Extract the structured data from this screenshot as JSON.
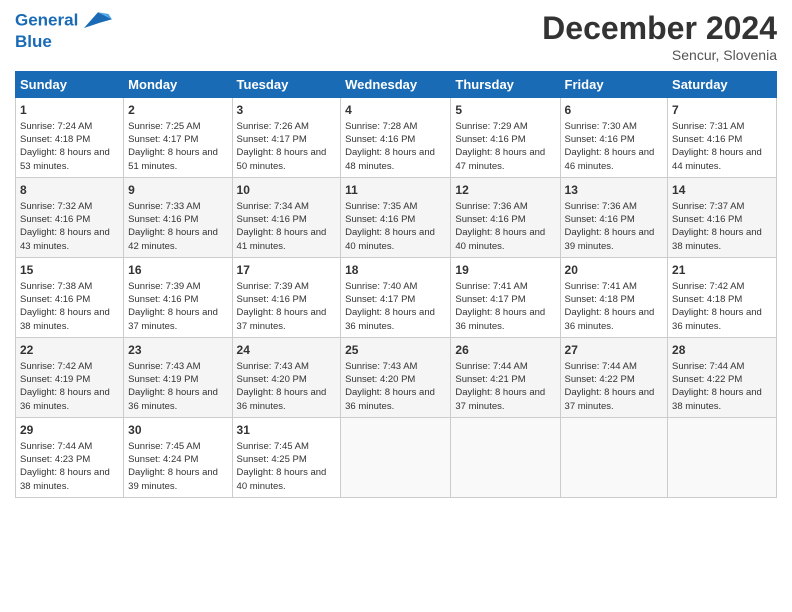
{
  "logo": {
    "line1": "General",
    "line2": "Blue"
  },
  "title": "December 2024",
  "subtitle": "Sencur, Slovenia",
  "headers": [
    "Sunday",
    "Monday",
    "Tuesday",
    "Wednesday",
    "Thursday",
    "Friday",
    "Saturday"
  ],
  "weeks": [
    [
      {
        "day": "1",
        "sunrise": "Sunrise: 7:24 AM",
        "sunset": "Sunset: 4:18 PM",
        "daylight": "Daylight: 8 hours and 53 minutes."
      },
      {
        "day": "2",
        "sunrise": "Sunrise: 7:25 AM",
        "sunset": "Sunset: 4:17 PM",
        "daylight": "Daylight: 8 hours and 51 minutes."
      },
      {
        "day": "3",
        "sunrise": "Sunrise: 7:26 AM",
        "sunset": "Sunset: 4:17 PM",
        "daylight": "Daylight: 8 hours and 50 minutes."
      },
      {
        "day": "4",
        "sunrise": "Sunrise: 7:28 AM",
        "sunset": "Sunset: 4:16 PM",
        "daylight": "Daylight: 8 hours and 48 minutes."
      },
      {
        "day": "5",
        "sunrise": "Sunrise: 7:29 AM",
        "sunset": "Sunset: 4:16 PM",
        "daylight": "Daylight: 8 hours and 47 minutes."
      },
      {
        "day": "6",
        "sunrise": "Sunrise: 7:30 AM",
        "sunset": "Sunset: 4:16 PM",
        "daylight": "Daylight: 8 hours and 46 minutes."
      },
      {
        "day": "7",
        "sunrise": "Sunrise: 7:31 AM",
        "sunset": "Sunset: 4:16 PM",
        "daylight": "Daylight: 8 hours and 44 minutes."
      }
    ],
    [
      {
        "day": "8",
        "sunrise": "Sunrise: 7:32 AM",
        "sunset": "Sunset: 4:16 PM",
        "daylight": "Daylight: 8 hours and 43 minutes."
      },
      {
        "day": "9",
        "sunrise": "Sunrise: 7:33 AM",
        "sunset": "Sunset: 4:16 PM",
        "daylight": "Daylight: 8 hours and 42 minutes."
      },
      {
        "day": "10",
        "sunrise": "Sunrise: 7:34 AM",
        "sunset": "Sunset: 4:16 PM",
        "daylight": "Daylight: 8 hours and 41 minutes."
      },
      {
        "day": "11",
        "sunrise": "Sunrise: 7:35 AM",
        "sunset": "Sunset: 4:16 PM",
        "daylight": "Daylight: 8 hours and 40 minutes."
      },
      {
        "day": "12",
        "sunrise": "Sunrise: 7:36 AM",
        "sunset": "Sunset: 4:16 PM",
        "daylight": "Daylight: 8 hours and 40 minutes."
      },
      {
        "day": "13",
        "sunrise": "Sunrise: 7:36 AM",
        "sunset": "Sunset: 4:16 PM",
        "daylight": "Daylight: 8 hours and 39 minutes."
      },
      {
        "day": "14",
        "sunrise": "Sunrise: 7:37 AM",
        "sunset": "Sunset: 4:16 PM",
        "daylight": "Daylight: 8 hours and 38 minutes."
      }
    ],
    [
      {
        "day": "15",
        "sunrise": "Sunrise: 7:38 AM",
        "sunset": "Sunset: 4:16 PM",
        "daylight": "Daylight: 8 hours and 38 minutes."
      },
      {
        "day": "16",
        "sunrise": "Sunrise: 7:39 AM",
        "sunset": "Sunset: 4:16 PM",
        "daylight": "Daylight: 8 hours and 37 minutes."
      },
      {
        "day": "17",
        "sunrise": "Sunrise: 7:39 AM",
        "sunset": "Sunset: 4:16 PM",
        "daylight": "Daylight: 8 hours and 37 minutes."
      },
      {
        "day": "18",
        "sunrise": "Sunrise: 7:40 AM",
        "sunset": "Sunset: 4:17 PM",
        "daylight": "Daylight: 8 hours and 36 minutes."
      },
      {
        "day": "19",
        "sunrise": "Sunrise: 7:41 AM",
        "sunset": "Sunset: 4:17 PM",
        "daylight": "Daylight: 8 hours and 36 minutes."
      },
      {
        "day": "20",
        "sunrise": "Sunrise: 7:41 AM",
        "sunset": "Sunset: 4:18 PM",
        "daylight": "Daylight: 8 hours and 36 minutes."
      },
      {
        "day": "21",
        "sunrise": "Sunrise: 7:42 AM",
        "sunset": "Sunset: 4:18 PM",
        "daylight": "Daylight: 8 hours and 36 minutes."
      }
    ],
    [
      {
        "day": "22",
        "sunrise": "Sunrise: 7:42 AM",
        "sunset": "Sunset: 4:19 PM",
        "daylight": "Daylight: 8 hours and 36 minutes."
      },
      {
        "day": "23",
        "sunrise": "Sunrise: 7:43 AM",
        "sunset": "Sunset: 4:19 PM",
        "daylight": "Daylight: 8 hours and 36 minutes."
      },
      {
        "day": "24",
        "sunrise": "Sunrise: 7:43 AM",
        "sunset": "Sunset: 4:20 PM",
        "daylight": "Daylight: 8 hours and 36 minutes."
      },
      {
        "day": "25",
        "sunrise": "Sunrise: 7:43 AM",
        "sunset": "Sunset: 4:20 PM",
        "daylight": "Daylight: 8 hours and 36 minutes."
      },
      {
        "day": "26",
        "sunrise": "Sunrise: 7:44 AM",
        "sunset": "Sunset: 4:21 PM",
        "daylight": "Daylight: 8 hours and 37 minutes."
      },
      {
        "day": "27",
        "sunrise": "Sunrise: 7:44 AM",
        "sunset": "Sunset: 4:22 PM",
        "daylight": "Daylight: 8 hours and 37 minutes."
      },
      {
        "day": "28",
        "sunrise": "Sunrise: 7:44 AM",
        "sunset": "Sunset: 4:22 PM",
        "daylight": "Daylight: 8 hours and 38 minutes."
      }
    ],
    [
      {
        "day": "29",
        "sunrise": "Sunrise: 7:44 AM",
        "sunset": "Sunset: 4:23 PM",
        "daylight": "Daylight: 8 hours and 38 minutes."
      },
      {
        "day": "30",
        "sunrise": "Sunrise: 7:45 AM",
        "sunset": "Sunset: 4:24 PM",
        "daylight": "Daylight: 8 hours and 39 minutes."
      },
      {
        "day": "31",
        "sunrise": "Sunrise: 7:45 AM",
        "sunset": "Sunset: 4:25 PM",
        "daylight": "Daylight: 8 hours and 40 minutes."
      },
      null,
      null,
      null,
      null
    ]
  ]
}
